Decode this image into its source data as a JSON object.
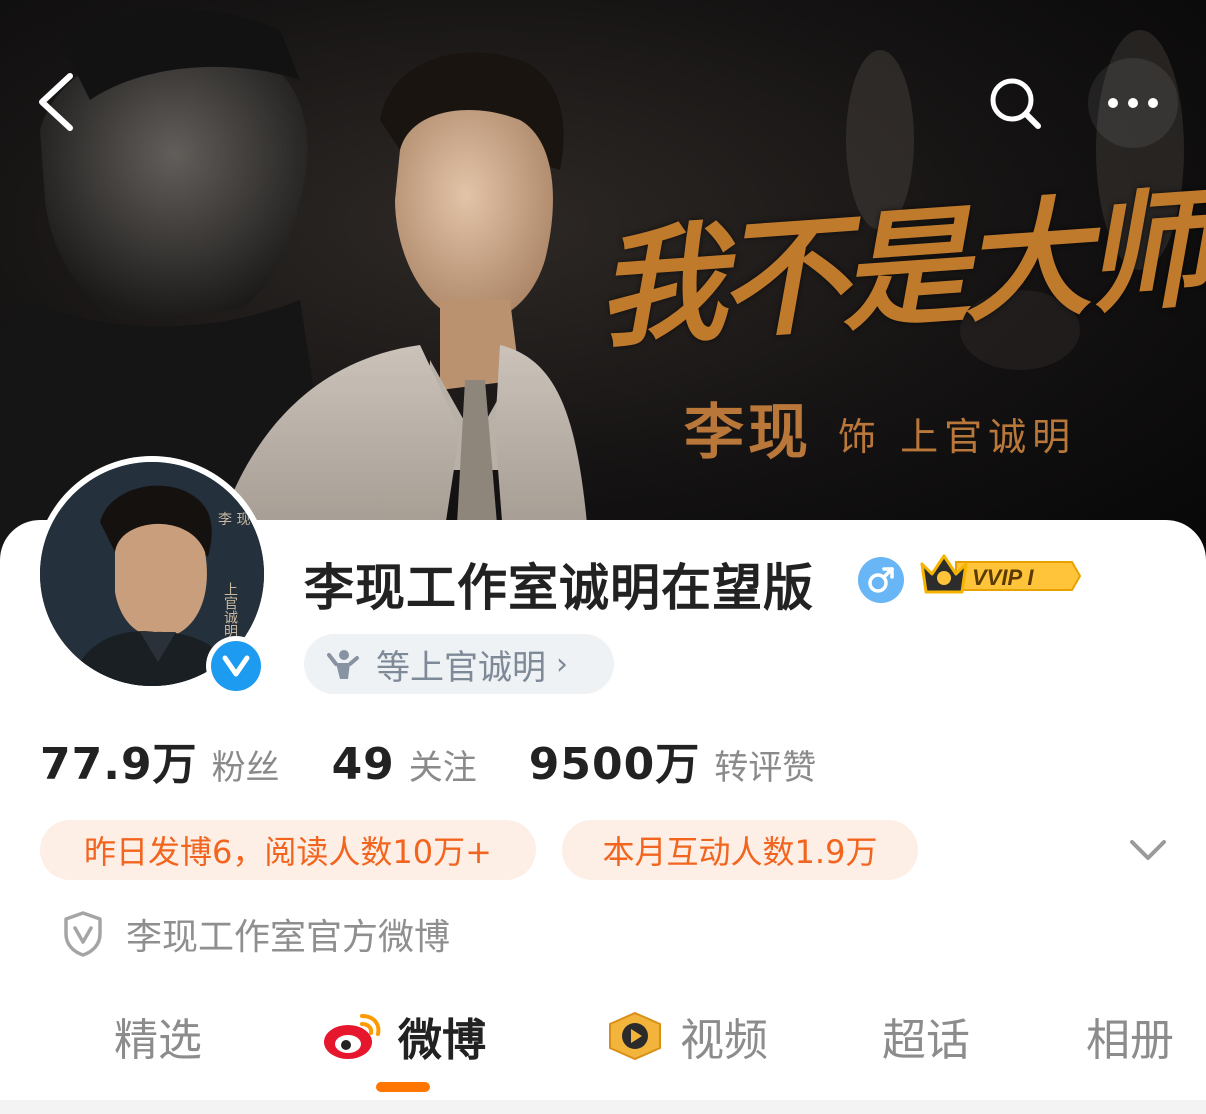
{
  "banner": {
    "poster_title": "我不是大师",
    "poster_actor": "李现",
    "poster_role": "饰 上官诚明",
    "avatar_text_1": "李 现",
    "avatar_text_2": "上官诚明"
  },
  "nav": {
    "back_icon": "chevron-left-icon",
    "search_icon": "search-icon",
    "more_icon": "more-horizontal-icon"
  },
  "profile": {
    "name": "李现工作室诚明在望版",
    "gender": "male",
    "vvip_label": "VVIP I",
    "role_pill": "等上官诚明",
    "role_chevron": "›",
    "verified": true
  },
  "stats": [
    {
      "value": "77.9万",
      "label": "粉丝"
    },
    {
      "value": "49",
      "label": "关注"
    },
    {
      "value": "9500万",
      "label": "转评赞"
    }
  ],
  "chips": {
    "posts": "昨日发博6，阅读人数10万+",
    "interactions": "本月互动人数1.9万"
  },
  "official": {
    "label": "李现工作室官方微博"
  },
  "tabs": [
    {
      "label": "精选",
      "active": false
    },
    {
      "label": "微博",
      "active": true
    },
    {
      "label": "视频",
      "active": false
    },
    {
      "label": "超话",
      "active": false
    },
    {
      "label": "相册",
      "active": false
    }
  ],
  "colors": {
    "accent": "#ff7700",
    "chip_bg": "#fdeee6",
    "chip_text": "#f2651f",
    "verify_blue": "#1d9bf0",
    "poster_gold": "#c07a2c"
  }
}
